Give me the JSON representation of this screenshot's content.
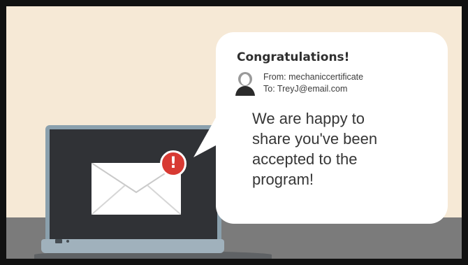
{
  "notification": {
    "title": "Congratulations!",
    "from": "From: mechaniccertificate",
    "to": "To: TreyJ@email.com",
    "message_lines": [
      "We are happy to",
      "share you've been",
      "accepted to the",
      "program!"
    ]
  },
  "alert": {
    "symbol": "!",
    "color": "#d83a33"
  },
  "icons": {
    "envelope": "envelope-icon",
    "avatar": "user-avatar-icon",
    "alert": "exclamation-alert-icon"
  },
  "colors": {
    "wall": "#f6e9d6",
    "desk": "#7b7b7b",
    "laptop_frame": "#8aa0ad",
    "laptop_screen": "#303236",
    "bubble": "#ffffff"
  }
}
